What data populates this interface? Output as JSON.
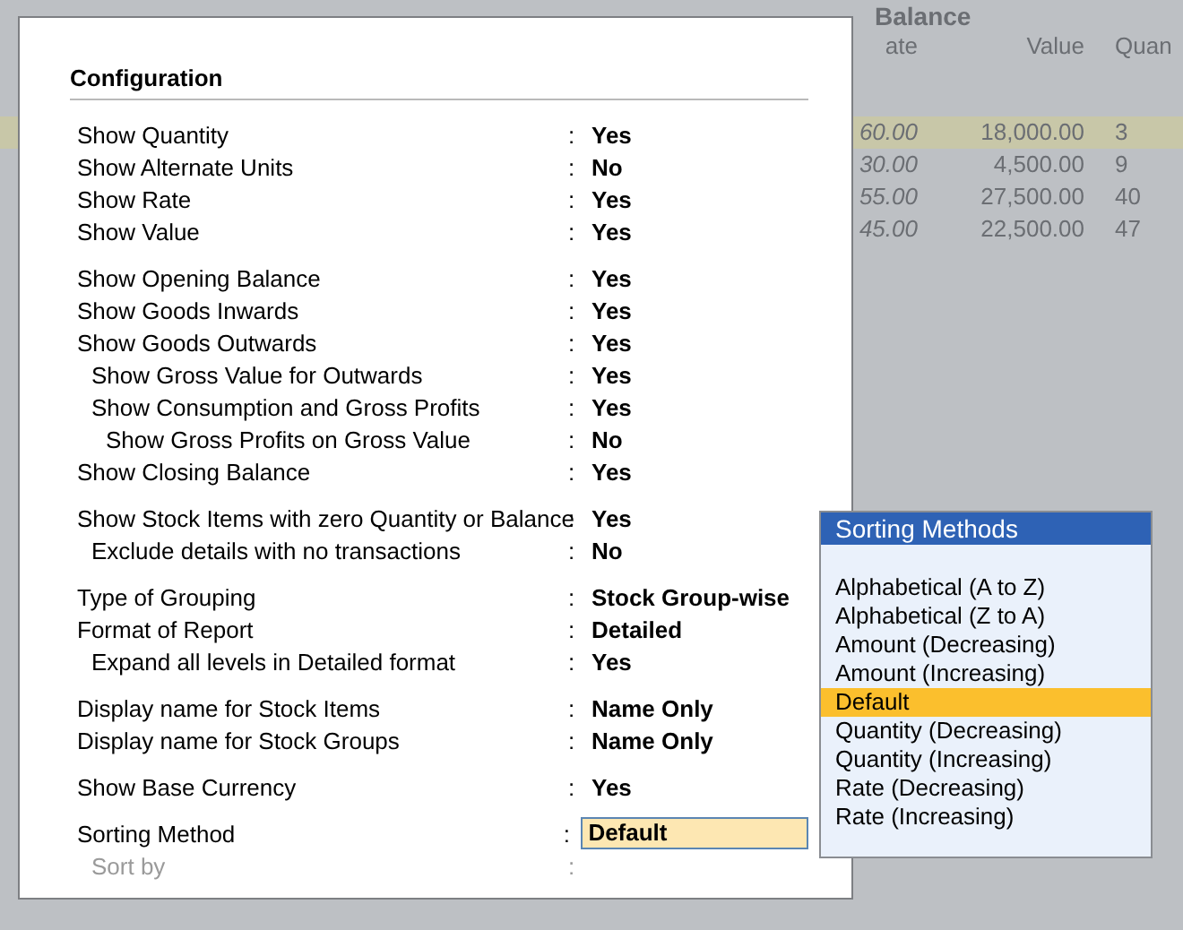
{
  "background_report": {
    "group_heading": "Balance",
    "columns": [
      "ate",
      "Value",
      "Quan"
    ],
    "rows": [
      {
        "cells": [
          "60.00",
          "18,000.00",
          "3"
        ],
        "selected": true
      },
      {
        "cells": [
          "30.00",
          "4,500.00",
          "9"
        ],
        "selected": false
      },
      {
        "cells": [
          "55.00",
          "27,500.00",
          "40"
        ],
        "selected": false
      },
      {
        "cells": [
          "45.00",
          "22,500.00",
          "47"
        ],
        "selected": false
      }
    ]
  },
  "configuration": {
    "title": "Configuration",
    "separator": ":",
    "groups": [
      {
        "rows": [
          {
            "label": "Show Quantity",
            "value": "Yes"
          },
          {
            "label": "Show Alternate Units",
            "value": "No"
          },
          {
            "label": "Show Rate",
            "value": "Yes"
          },
          {
            "label": "Show Value",
            "value": "Yes"
          }
        ]
      },
      {
        "rows": [
          {
            "label": "Show Opening Balance",
            "value": "Yes"
          },
          {
            "label": "Show Goods Inwards",
            "value": "Yes"
          },
          {
            "label": "Show Goods Outwards",
            "value": "Yes",
            "children": [
              {
                "label": "Show Gross Value for Outwards",
                "value": "Yes"
              },
              {
                "label": "Show Consumption and Gross Profits",
                "value": "Yes",
                "children": [
                  {
                    "label": "Show Gross Profits on Gross Value",
                    "value": "No"
                  }
                ]
              }
            ]
          },
          {
            "label": "Show Closing Balance",
            "value": "Yes"
          }
        ]
      },
      {
        "rows": [
          {
            "label": "Show Stock Items with zero Quantity or Balance",
            "value": "Yes",
            "children": [
              {
                "label": "Exclude details with no transactions",
                "value": "No"
              }
            ]
          }
        ]
      },
      {
        "rows": [
          {
            "label": "Type of Grouping",
            "value": "Stock Group-wise"
          },
          {
            "label": "Format of Report",
            "value": "Detailed",
            "children": [
              {
                "label": "Expand all levels in Detailed format",
                "value": "Yes"
              }
            ]
          }
        ]
      },
      {
        "rows": [
          {
            "label": "Display name for Stock Items",
            "value": "Name Only"
          },
          {
            "label": "Display name for Stock Groups",
            "value": "Name Only"
          }
        ]
      },
      {
        "rows": [
          {
            "label": "Show Base Currency",
            "value": "Yes"
          }
        ]
      },
      {
        "rows": [
          {
            "label": "Sorting Method",
            "value": "Default",
            "focused": true,
            "children": [
              {
                "label": "Sort by",
                "disabled": true
              }
            ]
          }
        ]
      }
    ]
  },
  "sorting_methods": {
    "title": "Sorting Methods",
    "items": [
      {
        "label": "Alphabetical (A to Z)",
        "selected": false
      },
      {
        "label": "Alphabetical (Z to A)",
        "selected": false
      },
      {
        "label": "Amount (Decreasing)",
        "selected": false
      },
      {
        "label": "Amount (Increasing)",
        "selected": false
      },
      {
        "label": "Default",
        "selected": true
      },
      {
        "label": "Quantity (Decreasing)",
        "selected": false
      },
      {
        "label": "Quantity (Increasing)",
        "selected": false
      },
      {
        "label": "Rate (Decreasing)",
        "selected": false
      },
      {
        "label": "Rate (Increasing)",
        "selected": false
      }
    ]
  }
}
